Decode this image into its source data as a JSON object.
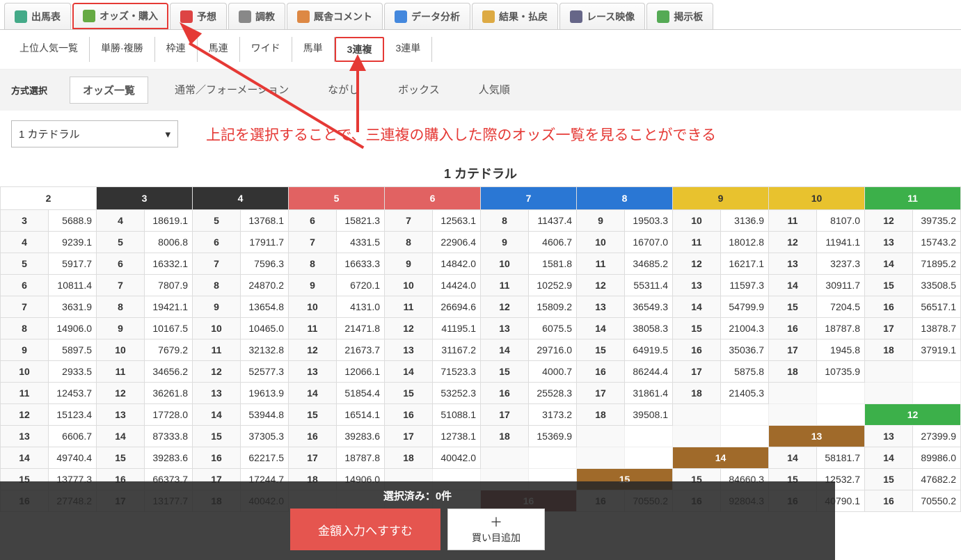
{
  "mainTabs": [
    {
      "label": "出馬表",
      "icon": "table-icon"
    },
    {
      "label": "オッズ・購入",
      "icon": "odds-icon",
      "highlight": true
    },
    {
      "label": "予想",
      "icon": "target-icon"
    },
    {
      "label": "調教",
      "icon": "clock-icon"
    },
    {
      "label": "厩舎コメント",
      "icon": "comment-icon"
    },
    {
      "label": "データ分析",
      "icon": "chart-icon"
    },
    {
      "label": "結果・払戻",
      "icon": "coins-icon"
    },
    {
      "label": "レース映像",
      "icon": "video-icon"
    },
    {
      "label": "掲示板",
      "icon": "board-icon"
    }
  ],
  "subTabs": [
    "上位人気一覧",
    "単勝·複勝",
    "枠連",
    "馬連",
    "ワイド",
    "馬単",
    "3連複",
    "3連単"
  ],
  "subTabHighlight": 6,
  "methodLabel": "方式選択",
  "methodTabs": [
    "オッズ一覧",
    "通常／フォーメーション",
    "ながし",
    "ボックス",
    "人気順"
  ],
  "methodActive": 0,
  "horseSelect": "1 カテドラル",
  "annotation": "上記を選択することで、三連複の購入した際のオッズ一覧を見ることができる",
  "tableTitle": "1 カテドラル",
  "headers": [
    {
      "n": "2",
      "cls": "head-white"
    },
    {
      "n": "3",
      "cls": "head-black"
    },
    {
      "n": "4",
      "cls": "head-black"
    },
    {
      "n": "5",
      "cls": "head-red"
    },
    {
      "n": "6",
      "cls": "head-red"
    },
    {
      "n": "7",
      "cls": "head-blue"
    },
    {
      "n": "8",
      "cls": "head-blue"
    },
    {
      "n": "9",
      "cls": "head-yellow"
    },
    {
      "n": "10",
      "cls": "head-yellow"
    },
    {
      "n": "11",
      "cls": "head-green"
    }
  ],
  "rows": [
    [
      [
        "3",
        "5688.9"
      ],
      [
        "4",
        "18619.1"
      ],
      [
        "5",
        "13768.1"
      ],
      [
        "6",
        "15821.3"
      ],
      [
        "7",
        "12563.1"
      ],
      [
        "8",
        "11437.4"
      ],
      [
        "9",
        "19503.3"
      ],
      [
        "10",
        "3136.9"
      ],
      [
        "11",
        "8107.0"
      ],
      [
        "12",
        "39735.2"
      ]
    ],
    [
      [
        "4",
        "9239.1"
      ],
      [
        "5",
        "8006.8"
      ],
      [
        "6",
        "17911.7"
      ],
      [
        "7",
        "4331.5"
      ],
      [
        "8",
        "22906.4"
      ],
      [
        "9",
        "4606.7"
      ],
      [
        "10",
        "16707.0"
      ],
      [
        "11",
        "18012.8"
      ],
      [
        "12",
        "11941.1"
      ],
      [
        "13",
        "15743.2"
      ]
    ],
    [
      [
        "5",
        "5917.7"
      ],
      [
        "6",
        "16332.1"
      ],
      [
        "7",
        "7596.3"
      ],
      [
        "8",
        "16633.3"
      ],
      [
        "9",
        "14842.0"
      ],
      [
        "10",
        "1581.8"
      ],
      [
        "11",
        "34685.2"
      ],
      [
        "12",
        "16217.1"
      ],
      [
        "13",
        "3237.3"
      ],
      [
        "14",
        "71895.2"
      ]
    ],
    [
      [
        "6",
        "10811.4"
      ],
      [
        "7",
        "7807.9"
      ],
      [
        "8",
        "24870.2"
      ],
      [
        "9",
        "6720.1"
      ],
      [
        "10",
        "14424.0"
      ],
      [
        "11",
        "10252.9"
      ],
      [
        "12",
        "55311.4"
      ],
      [
        "13",
        "11597.3"
      ],
      [
        "14",
        "30911.7"
      ],
      [
        "15",
        "33508.5"
      ]
    ],
    [
      [
        "7",
        "3631.9"
      ],
      [
        "8",
        "19421.1"
      ],
      [
        "9",
        "13654.8"
      ],
      [
        "10",
        "4131.0"
      ],
      [
        "11",
        "26694.6"
      ],
      [
        "12",
        "15809.2"
      ],
      [
        "13",
        "36549.3"
      ],
      [
        "14",
        "54799.9"
      ],
      [
        "15",
        "7204.5"
      ],
      [
        "16",
        "56517.1"
      ]
    ],
    [
      [
        "8",
        "14906.0"
      ],
      [
        "9",
        "10167.5"
      ],
      [
        "10",
        "10465.0"
      ],
      [
        "11",
        "21471.8"
      ],
      [
        "12",
        "41195.1"
      ],
      [
        "13",
        "6075.5"
      ],
      [
        "14",
        "38058.3"
      ],
      [
        "15",
        "21004.3"
      ],
      [
        "16",
        "18787.8"
      ],
      [
        "17",
        "13878.7"
      ]
    ],
    [
      [
        "9",
        "5897.5"
      ],
      [
        "10",
        "7679.2"
      ],
      [
        "11",
        "32132.8"
      ],
      [
        "12",
        "21673.7"
      ],
      [
        "13",
        "31167.2"
      ],
      [
        "14",
        "29716.0"
      ],
      [
        "15",
        "64919.5"
      ],
      [
        "16",
        "35036.7"
      ],
      [
        "17",
        "1945.8"
      ],
      [
        "18",
        "37919.1"
      ]
    ],
    [
      [
        "10",
        "2933.5"
      ],
      [
        "11",
        "34656.2"
      ],
      [
        "12",
        "52577.3"
      ],
      [
        "13",
        "12066.1"
      ],
      [
        "14",
        "71523.3"
      ],
      [
        "15",
        "4000.7"
      ],
      [
        "16",
        "86244.4"
      ],
      [
        "17",
        "5875.8"
      ],
      [
        "18",
        "10735.9"
      ],
      [
        "",
        ""
      ]
    ],
    [
      [
        "11",
        "12453.7"
      ],
      [
        "12",
        "36261.8"
      ],
      [
        "13",
        "19613.9"
      ],
      [
        "14",
        "51854.4"
      ],
      [
        "15",
        "53252.3"
      ],
      [
        "16",
        "25528.3"
      ],
      [
        "17",
        "31861.4"
      ],
      [
        "18",
        "21405.3"
      ],
      [
        "",
        ""
      ],
      [
        "",
        ""
      ]
    ],
    [
      [
        "12",
        "15123.4"
      ],
      [
        "13",
        "17728.0"
      ],
      [
        "14",
        "53944.8"
      ],
      [
        "15",
        "16514.1"
      ],
      [
        "16",
        "51088.1"
      ],
      [
        "17",
        "3173.2"
      ],
      [
        "18",
        "39508.1"
      ],
      [
        "",
        ""
      ],
      [
        "",
        ""
      ],
      [
        "",
        ""
      ]
    ]
  ],
  "subHeader12": "12",
  "bottomRows": [
    [
      [
        "13",
        "6606.7"
      ],
      [
        "14",
        "87333.8"
      ],
      [
        "15",
        "37305.3"
      ],
      [
        "16",
        "39283.6"
      ],
      [
        "17",
        "12738.1"
      ],
      [
        "18",
        "15369.9"
      ],
      [
        "",
        ""
      ],
      [
        "",
        ""
      ],
      [
        "13",
        ""
      ],
      [
        "13",
        "27399.9"
      ]
    ],
    [
      [
        "14",
        "49740.4"
      ],
      [
        "15",
        "39283.6"
      ],
      [
        "16",
        "62217.5"
      ],
      [
        "17",
        "18787.8"
      ],
      [
        "18",
        "40042.0"
      ],
      [
        "",
        ""
      ],
      [
        "",
        ""
      ],
      [
        "14",
        ""
      ],
      [
        "14",
        "58181.7"
      ],
      [
        "14",
        "89986.0"
      ]
    ],
    [
      [
        "15",
        "13777.3"
      ],
      [
        "16",
        "66373.7"
      ],
      [
        "17",
        "17244.7"
      ],
      [
        "18",
        "14906.0"
      ],
      [
        "",
        ""
      ],
      [
        "",
        ""
      ],
      [
        "15",
        ""
      ],
      [
        "15",
        "84660.3"
      ],
      [
        "15",
        "12532.7"
      ],
      [
        "15",
        "47682.2"
      ]
    ],
    [
      [
        "16",
        "27748.2"
      ],
      [
        "17",
        "13177.7"
      ],
      [
        "18",
        "40042.0"
      ],
      [
        "",
        ""
      ],
      [
        "",
        ""
      ],
      [
        "16",
        ""
      ],
      [
        "16",
        "70550.2"
      ],
      [
        "16",
        "92804.3"
      ],
      [
        "16",
        "40790.1"
      ],
      [
        "16",
        "70550.2"
      ]
    ]
  ],
  "overlay": {
    "selected": "選択済み：0件",
    "proceed": "金額入力へすすむ",
    "addPlus": "＋",
    "addLabel": "買い目追加"
  }
}
